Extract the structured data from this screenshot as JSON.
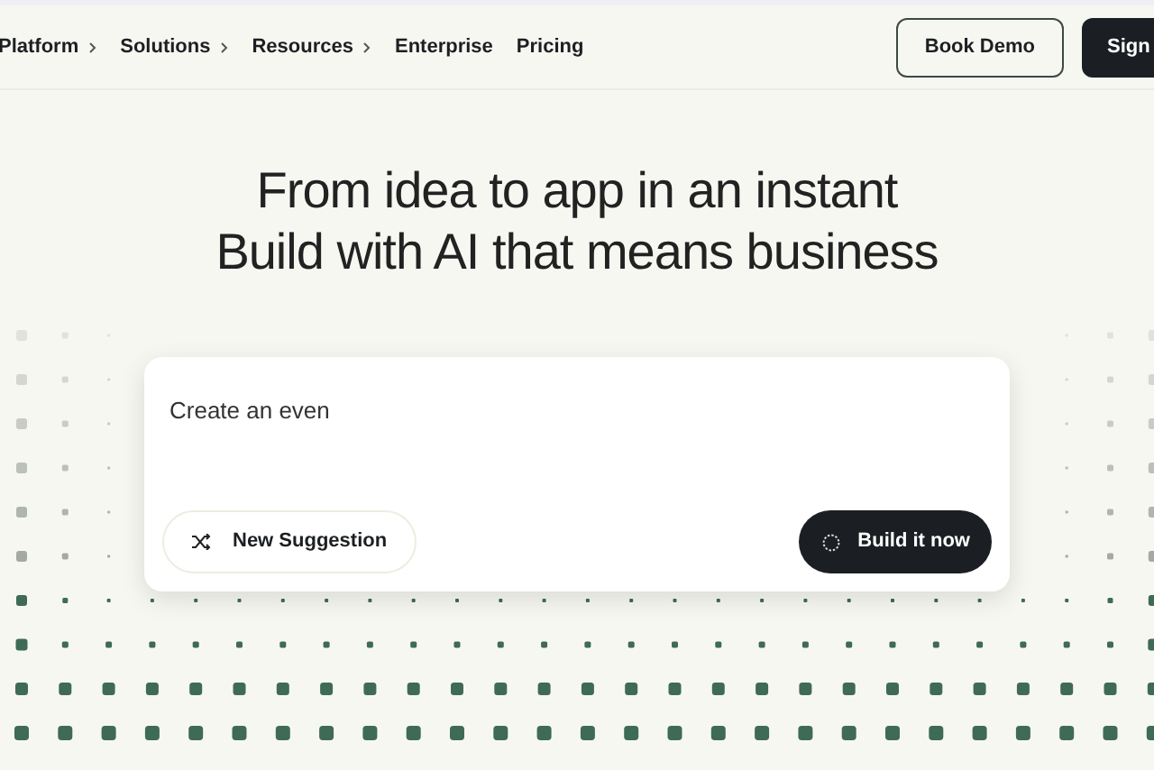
{
  "nav": {
    "items": [
      {
        "label": "Platform",
        "has_submenu": true
      },
      {
        "label": "Solutions",
        "has_submenu": true
      },
      {
        "label": "Resources",
        "has_submenu": true
      },
      {
        "label": "Enterprise",
        "has_submenu": false
      },
      {
        "label": "Pricing",
        "has_submenu": false
      }
    ],
    "buttons": [
      {
        "label": "Book Demo",
        "kind": "outline"
      },
      {
        "label": "Sign",
        "kind": "solid"
      }
    ]
  },
  "hero": {
    "headline": [
      "From idea to app in an instant",
      "Build with AI that means business"
    ]
  },
  "prompt": {
    "value": "Create an even",
    "secondary_button": "New Suggestion",
    "primary_button": "Build it now"
  }
}
